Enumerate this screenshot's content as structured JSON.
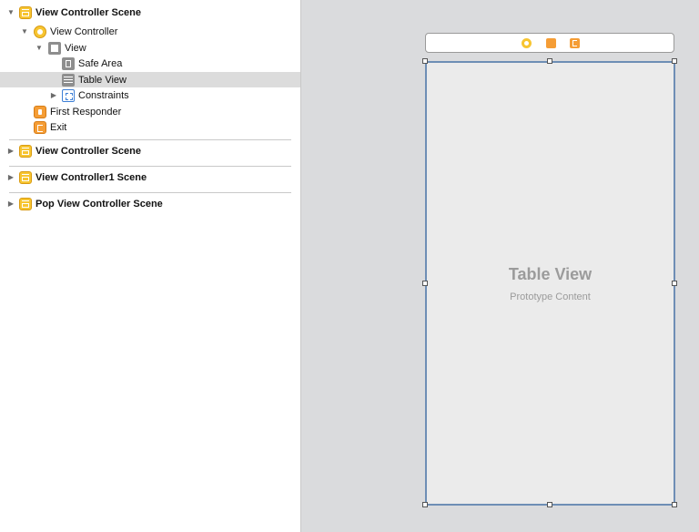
{
  "outline": {
    "items": [
      {
        "label": "View Controller Scene",
        "icon": "scene-icon",
        "expanded": true
      },
      {
        "label": "View Controller",
        "icon": "view-controller-icon",
        "expanded": true
      },
      {
        "label": "View",
        "icon": "view-icon",
        "expanded": true
      },
      {
        "label": "Safe Area",
        "icon": "safe-area-icon"
      },
      {
        "label": "Table View",
        "icon": "table-view-icon",
        "selected": true
      },
      {
        "label": "Constraints",
        "icon": "constraints-icon",
        "expanded": false
      },
      {
        "label": "First Responder",
        "icon": "first-responder-icon"
      },
      {
        "label": "Exit",
        "icon": "exit-icon"
      }
    ],
    "scenes": [
      {
        "label": "View Controller Scene",
        "expanded": false
      },
      {
        "label": "View Controller1 Scene",
        "expanded": false
      },
      {
        "label": "Pop View Controller Scene",
        "expanded": false
      }
    ]
  },
  "canvas": {
    "table_view": {
      "title": "Table View",
      "subtitle": "Prototype Content"
    }
  },
  "colors": {
    "scene_icon": "#f7c531",
    "responder_icon": "#f59d35",
    "selection_border": "#6e8eb5",
    "selected_row": "#dcdcdc"
  }
}
